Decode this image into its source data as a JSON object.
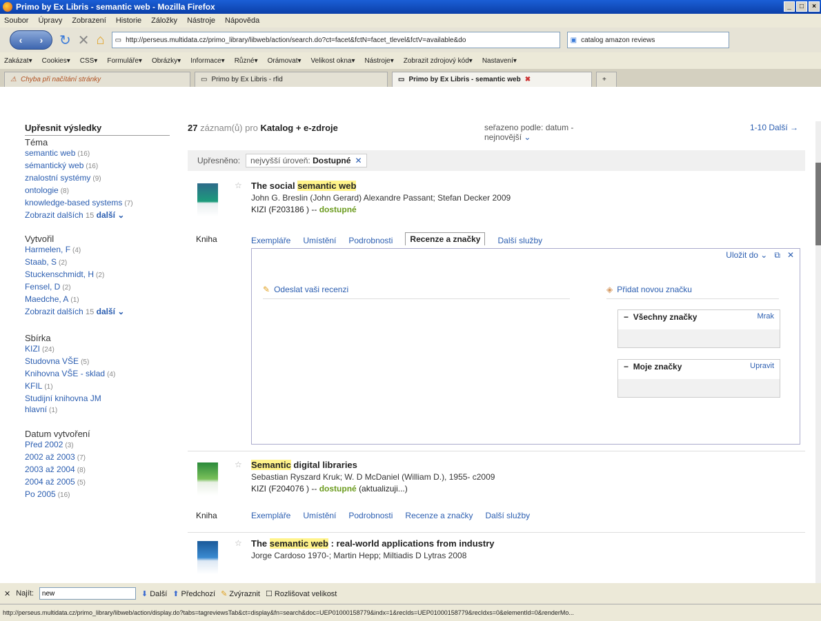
{
  "window": {
    "title": "Primo by Ex Libris - semantic web - Mozilla Firefox"
  },
  "menu": [
    "Soubor",
    "Úpravy",
    "Zobrazení",
    "Historie",
    "Záložky",
    "Nástroje",
    "Nápověda"
  ],
  "nav": {
    "url": "http://perseus.multidata.cz/primo_library/libweb/action/search.do?ct=facet&fctN=facet_tlevel&fctV=available&do",
    "search": "catalog amazon reviews"
  },
  "bookmarks": [
    "Zakázat▾",
    "Cookies▾",
    "CSS▾",
    "Formuláře▾",
    "Obrázky▾",
    "Informace▾",
    "Různé▾",
    "Orámovat▾",
    "Velikost okna▾",
    "Nástroje▾",
    "Zobrazit zdrojový kód▾",
    "Nastavení▾"
  ],
  "tabs": [
    "Chyba při načítání stránky",
    "Primo by Ex Libris - rfid",
    "Primo by Ex Libris - semantic web"
  ],
  "sidebar": {
    "title": "Upřesnit výsledky",
    "tema_label": "Téma",
    "tema": [
      {
        "t": "semantic web",
        "c": "(16)"
      },
      {
        "t": "sémantický web",
        "c": "(16)"
      },
      {
        "t": "znalostní systémy",
        "c": "(9)"
      },
      {
        "t": "ontologie",
        "c": "(8)"
      },
      {
        "t": "knowledge-based systems",
        "c": "(7)"
      }
    ],
    "more1": "Zobrazit dalších",
    "more1_count": "15",
    "more_label": "další ⌄",
    "vytvoril_label": "Vytvořil",
    "vytvoril": [
      {
        "t": "Harmelen, F",
        "c": "(4)"
      },
      {
        "t": "Staab, S",
        "c": "(2)"
      },
      {
        "t": "Stuckenschmidt, H",
        "c": "(2)"
      },
      {
        "t": "Fensel, D",
        "c": "(2)"
      },
      {
        "t": "Maedche, A",
        "c": "(1)"
      }
    ],
    "more2": "Zobrazit dalších",
    "more2_count": "15",
    "sbirka_label": "Sbírka",
    "sbirka": [
      {
        "t": "KIZI",
        "c": "(24)"
      },
      {
        "t": "Studovna VŠE",
        "c": "(5)"
      },
      {
        "t": "Knihovna VŠE - sklad",
        "c": "(4)"
      },
      {
        "t": "KFIL",
        "c": "(1)"
      },
      {
        "t": "Studijní knihovna JM hlavní",
        "c": "(1)"
      }
    ],
    "datum_label": "Datum vytvoření",
    "datum": [
      {
        "t": "Před 2002",
        "c": "(3)"
      },
      {
        "t": "2002 až 2003",
        "c": "(7)"
      },
      {
        "t": "2003 až 2004",
        "c": "(8)"
      },
      {
        "t": "2004 až 2005",
        "c": "(5)"
      },
      {
        "t": "Po 2005",
        "c": "(16)"
      }
    ]
  },
  "results": {
    "count": "27",
    "count_mid": "záznam(ů) pro",
    "scope": "Katalog + e-zdroje",
    "sort_label": "seřazeno podle:",
    "sort_value": "datum - nejnovější",
    "paging": "1-10 Další →",
    "refined_label": "Upřesněno:",
    "refined_field": "nejvyšší úroveň:",
    "refined_value": "Dostupné",
    "record_tabs": [
      "Exempláře",
      "Umístění",
      "Podrobnosti",
      "Recenze a značky",
      "Další služby"
    ],
    "type": "Kniha",
    "rec1": {
      "title_pre": "The social ",
      "title_hl": "semantic web",
      "author": "John G. Breslin (John Gerard) Alexandre Passant; Stefan Decker 2009",
      "loc": "KIZI  (F203186 ) --",
      "avail": "dostupné"
    },
    "panel": {
      "save": "Uložit do ⌄",
      "write_review": "Odeslat vaši recenzi",
      "add_tag": "Přidat novou značku",
      "all_tags": "Všechny značky",
      "cloud": "Mrak",
      "my_tags": "Moje značky",
      "edit": "Upravit"
    },
    "rec2": {
      "title_hl": "Semantic",
      "title_post": " digital libraries",
      "author": "Sebastian Ryszard Kruk; W. D McDaniel (William D.), 1955- c2009",
      "loc": "KIZI  (F204076 ) --",
      "avail": "dostupné",
      "update": "(aktualizuji...)"
    },
    "rec3": {
      "title_pre": "The ",
      "title_hl": "semantic web",
      "title_post": " : real-world applications from industry",
      "author": "Jorge Cardoso 1970-; Martin Hepp; Miltiadis D Lytras 2008"
    }
  },
  "find": {
    "label": "Najít:",
    "value": "new",
    "next": "Další",
    "prev": "Předchozí",
    "highlight": "Zvýraznit",
    "match_case": "Rozlišovat velikost"
  },
  "status": "http://perseus.multidata.cz/primo_library/libweb/action/display.do?tabs=tagreviewsTab&ct=display&fn=search&doc=UEP01000158779&indx=1&recIds=UEP01000158779&recIdxs=0&elementId=0&renderMo..."
}
